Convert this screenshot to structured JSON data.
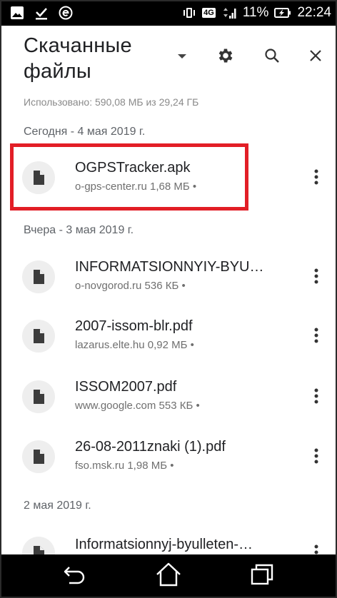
{
  "status_bar": {
    "network_label": "4G",
    "battery_percent": "11%",
    "time": "22:24",
    "icons": [
      "image-icon",
      "download-done-icon",
      "e-icon",
      "vibrate-icon",
      "network-4g-icon",
      "signal-icon",
      "battery-charging-icon"
    ]
  },
  "app_bar": {
    "title": "Скачанные файлы",
    "icons": [
      "dropdown-icon",
      "settings-icon",
      "search-icon",
      "close-icon"
    ]
  },
  "storage_info": "Использовано: 590,08 МБ из 29,24 ГБ",
  "sections": [
    {
      "header": "Сегодня - 4 мая 2019 г.",
      "items": [
        {
          "name": "OGPSTracker.apk",
          "meta": "o-gps-center.ru 1,68 МБ •"
        }
      ]
    },
    {
      "header": "Вчера - 3 мая 2019 г.",
      "items": [
        {
          "name": "INFORMATSIONNYIY-BYU…",
          "meta": "o-novgorod.ru 536 КБ •"
        },
        {
          "name": "2007-issom-blr.pdf",
          "meta": "lazarus.elte.hu 0,92 МБ •"
        },
        {
          "name": "ISSOM2007.pdf",
          "meta": "www.google.com 553 КБ •"
        },
        {
          "name": "26-08-2011znaki (1).pdf",
          "meta": "fso.msk.ru 1,98 МБ •"
        }
      ]
    },
    {
      "header": "2 мая 2019 г.",
      "items": [
        {
          "name": "Informatsionnyj-byulleten-…",
          "meta": ""
        }
      ]
    }
  ],
  "colors": {
    "highlight": "#e21e26",
    "status_bar_bg": "#000000",
    "nav_bar_bg": "#000000"
  },
  "nav_bar": {
    "icons": [
      "back-icon",
      "home-icon",
      "recent-apps-icon"
    ]
  }
}
